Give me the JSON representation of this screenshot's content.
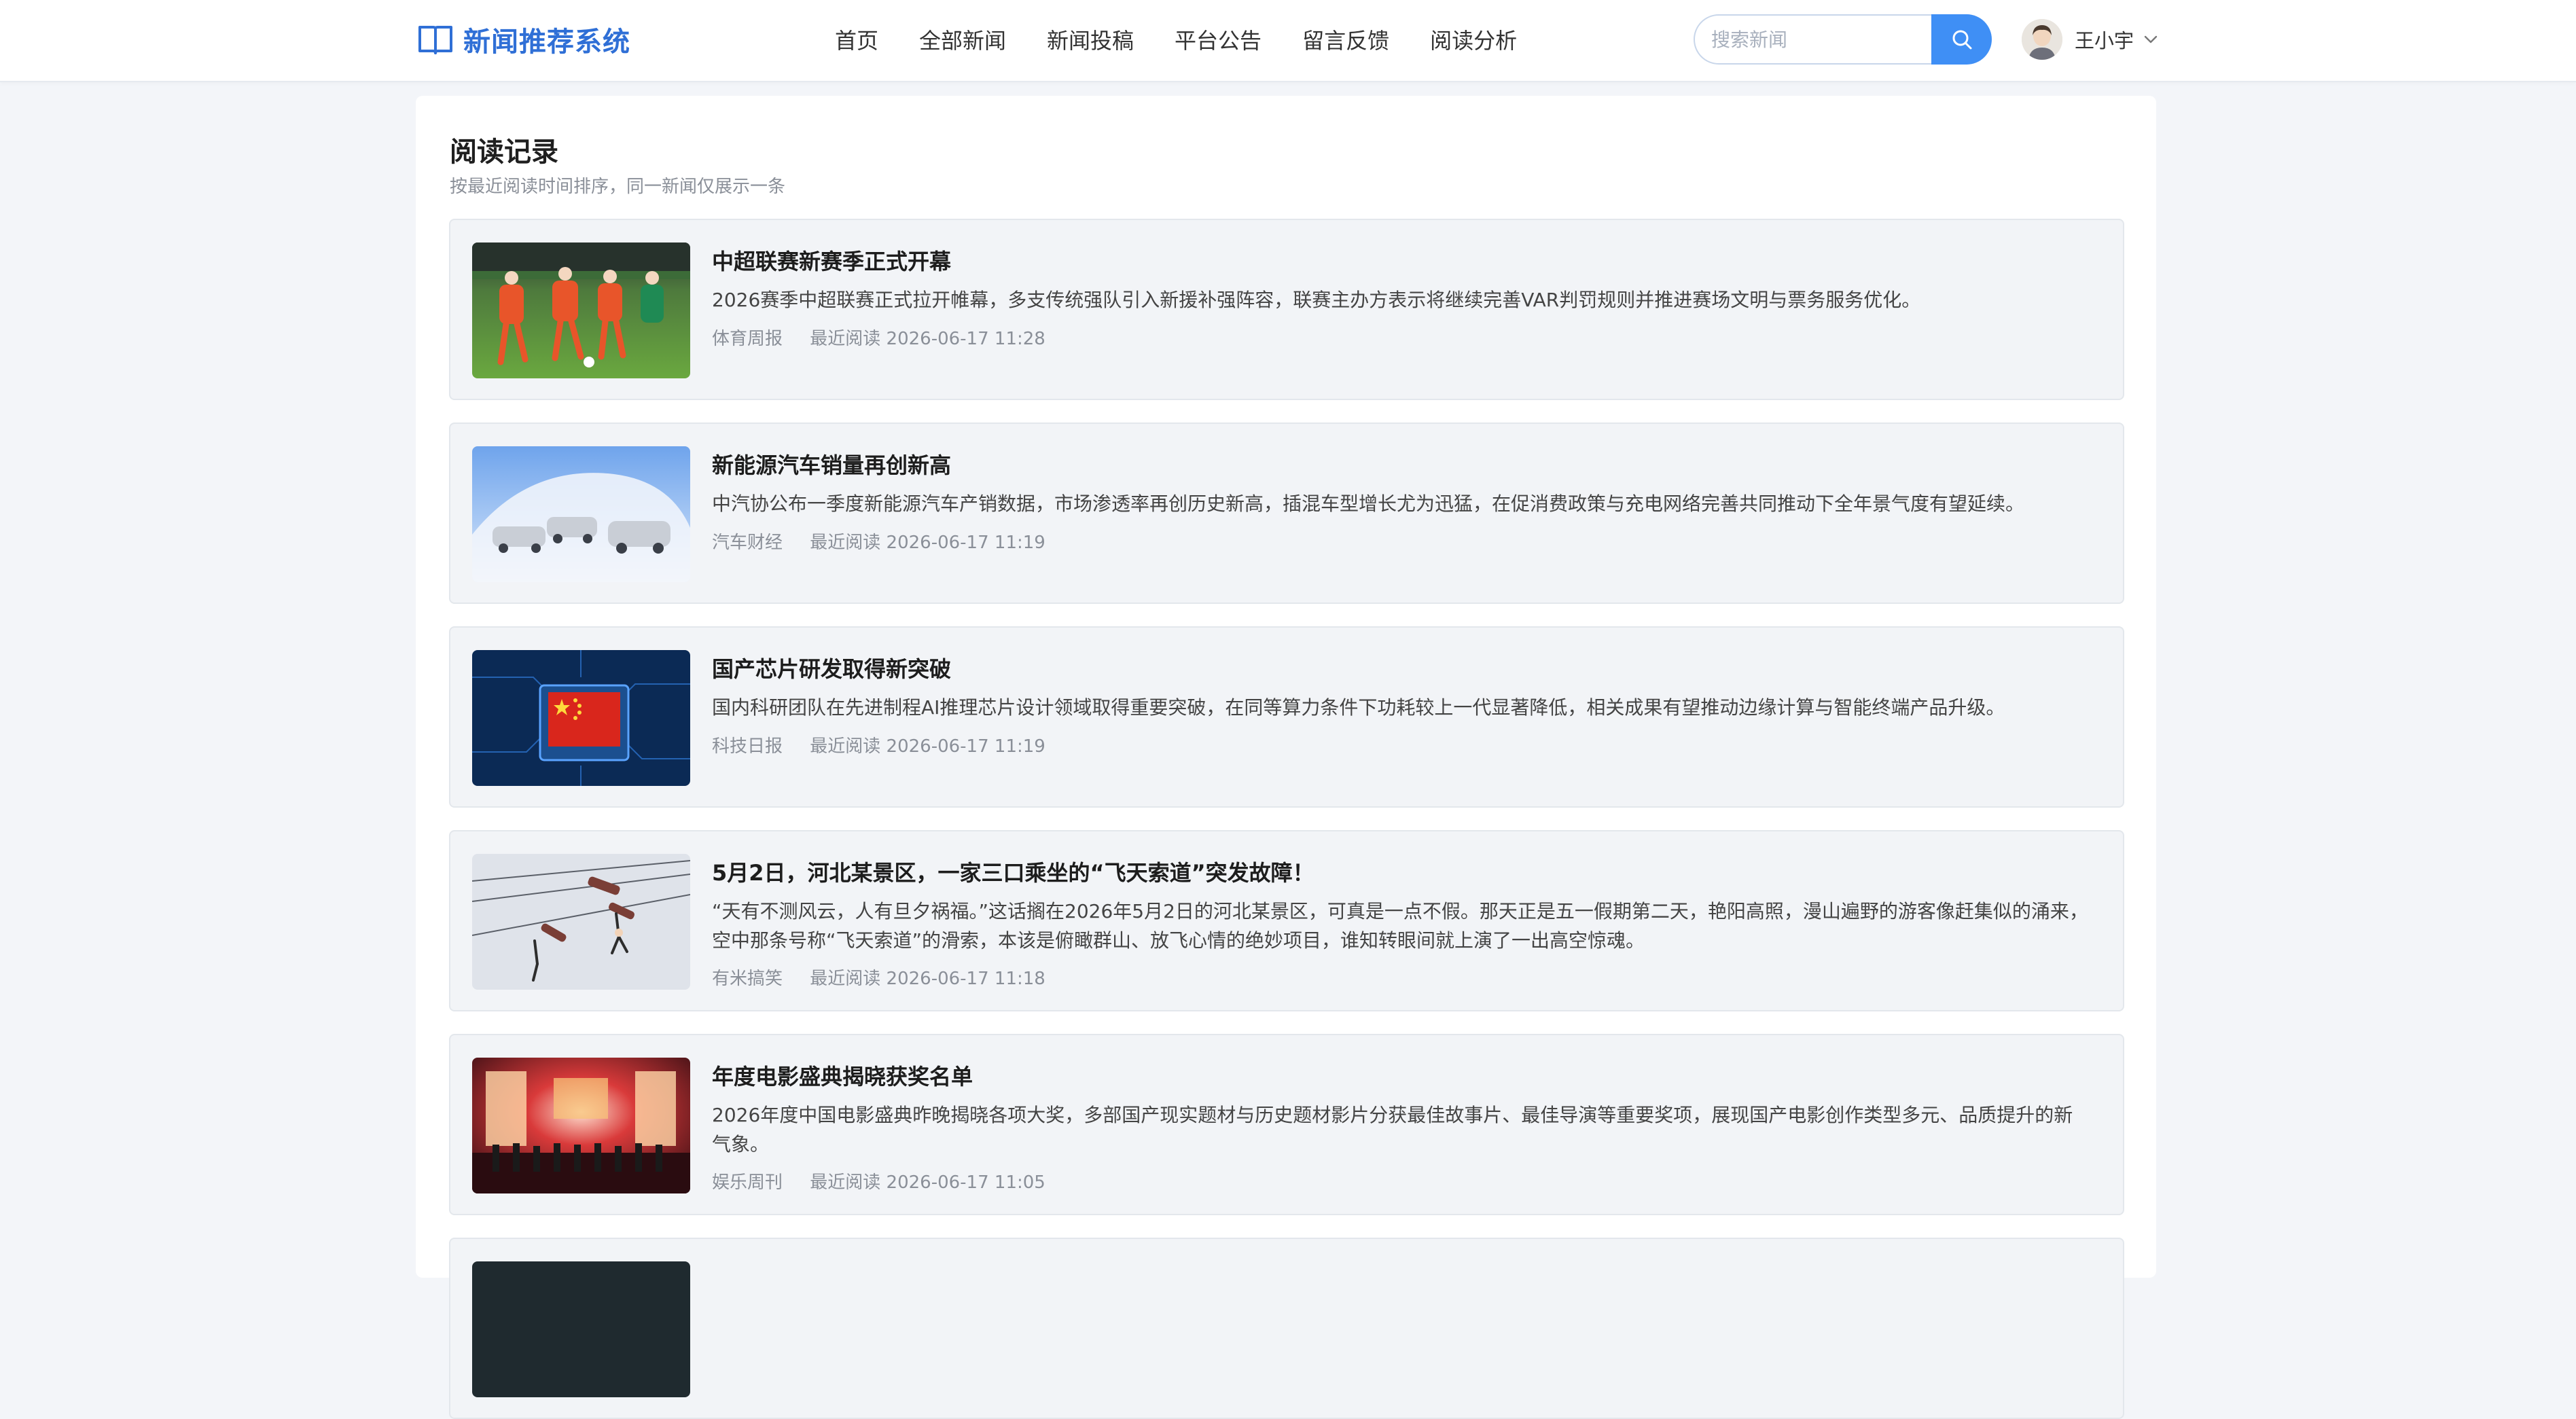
{
  "header": {
    "brand_title": "新闻推荐系统",
    "nav": [
      "首页",
      "全部新闻",
      "新闻投稿",
      "平台公告",
      "留言反馈",
      "阅读分析"
    ],
    "search_placeholder": "搜索新闻",
    "user_name": "王小宇",
    "accent_color": "#3f8ff5",
    "brand_color": "#2f6fd6"
  },
  "page": {
    "title": "阅读记录",
    "subtitle": "按最近阅读时间排序，同一新闻仅展示一条"
  },
  "records": [
    {
      "title": "中超联赛新赛季正式开幕",
      "summary": "2026赛季中超联赛正式拉开帷幕，多支传统强队引入新援补强阵容，联赛主办方表示将继续完善VAR判罚规则并推进赛场文明与票务服务优化。",
      "source": "体育周报",
      "read_time": "最近阅读 2026-06-17 11:28",
      "thumb_icon": "football-match-photo"
    },
    {
      "title": "新能源汽车销量再创新高",
      "summary": "中汽协公布一季度新能源汽车产销数据，市场渗透率再创历史新高，插混车型增长尤为迅猛，在促消费政策与充电网络完善共同推动下全年景气度有望延续。",
      "source": "汽车财经",
      "read_time": "最近阅读 2026-06-17 11:19",
      "thumb_icon": "electric-cars-photo"
    },
    {
      "title": "国产芯片研发取得新突破",
      "summary": "国内科研团队在先进制程AI推理芯片设计领域取得重要突破，在同等算力条件下功耗较上一代显著降低，相关成果有望推动边缘计算与智能终端产品升级。",
      "source": "科技日报",
      "read_time": "最近阅读 2026-06-17 11:19",
      "thumb_icon": "chip-flag-photo"
    },
    {
      "title": "5月2日，河北某景区，一家三口乘坐的“飞天索道”突发故障！",
      "summary": "“天有不测风云，人有旦夕祸福。”这话搁在2026年5月2日的河北某景区，可真是一点不假。那天正是五一假期第二天，艳阳高照，漫山遍野的游客像赶集似的涌来，空中那条号称“飞天索道”的滑索，本该是俯瞰群山、放飞心情的绝妙项目，谁知转眼间就上演了一出高空惊魂。",
      "source": "有米搞笑",
      "read_time": "最近阅读 2026-06-17 11:18",
      "thumb_icon": "zipline-photo"
    },
    {
      "title": "年度电影盛典揭晓获奖名单",
      "summary": "2026年度中国电影盛典昨晚揭晓各项大奖，多部国产现实题材与历史题材影片分获最佳故事片、最佳导演等重要奖项，展现国产电影创作类型多元、品质提升的新气象。",
      "source": "娱乐周刊",
      "read_time": "最近阅读 2026-06-17 11:05",
      "thumb_icon": "award-stage-photo"
    }
  ]
}
